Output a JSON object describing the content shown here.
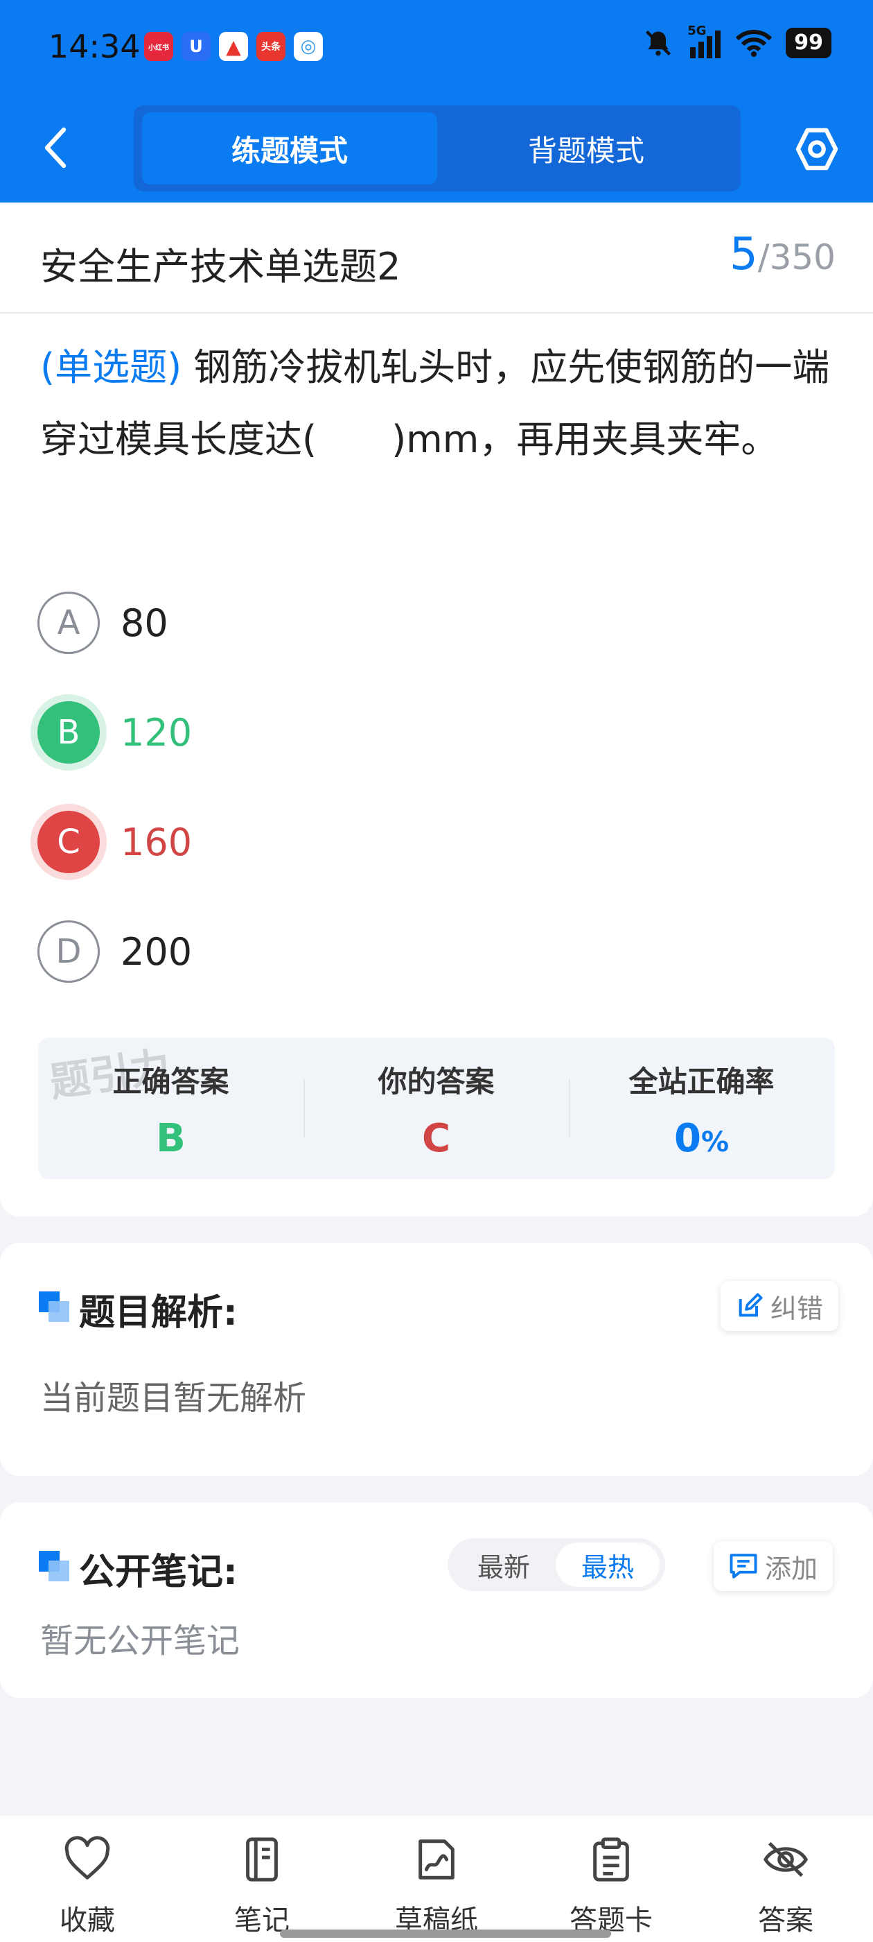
{
  "status_bar": {
    "time": "14:34",
    "apps": [
      {
        "label": "小红书",
        "color": "#e6283c"
      },
      {
        "label": "U",
        "color": "#2a6ef5"
      },
      {
        "label": "▲",
        "color": "#e8352d"
      },
      {
        "label": "头条",
        "color": "#e8352d"
      },
      {
        "label": "◎",
        "color": "#2f9bf0"
      }
    ],
    "network": "5G",
    "battery": "99"
  },
  "header": {
    "tab_practice": "练题模式",
    "tab_memorize": "背题模式"
  },
  "question": {
    "title": "安全生产技术单选题2",
    "current": "5",
    "separator": "/",
    "total": "350",
    "type_label": "(单选题)",
    "text": " 钢筋冷拔机轧头时，应先使钢筋的一端穿过模具长度达(　　)mm，再用夹具夹牢。",
    "options": [
      {
        "letter": "A",
        "text": "80",
        "state": "normal"
      },
      {
        "letter": "B",
        "text": "120",
        "state": "correct"
      },
      {
        "letter": "C",
        "text": "160",
        "state": "wrong"
      },
      {
        "letter": "D",
        "text": "200",
        "state": "normal"
      }
    ]
  },
  "answer_summary": {
    "watermark": "题引力",
    "correct_label": "正确答案",
    "correct_value": "B",
    "yours_label": "你的答案",
    "yours_value": "C",
    "rate_label": "全站正确率",
    "rate_value": "0",
    "rate_unit": "%"
  },
  "analysis": {
    "title": "题目解析:",
    "correct_button": "纠错",
    "body": "当前题目暂无解析"
  },
  "notes": {
    "title": "公开笔记:",
    "sort_newest": "最新",
    "sort_hottest": "最热",
    "add_button": "添加",
    "body": "暂无公开笔记"
  },
  "bottom_nav": {
    "favorite": "收藏",
    "notes": "笔记",
    "scratch": "草稿纸",
    "answer_card": "答题卡",
    "answer": "答案"
  },
  "colors": {
    "brand_blue": "#0a7bf0",
    "correct_green": "#33c07a",
    "wrong_red": "#e04545"
  }
}
